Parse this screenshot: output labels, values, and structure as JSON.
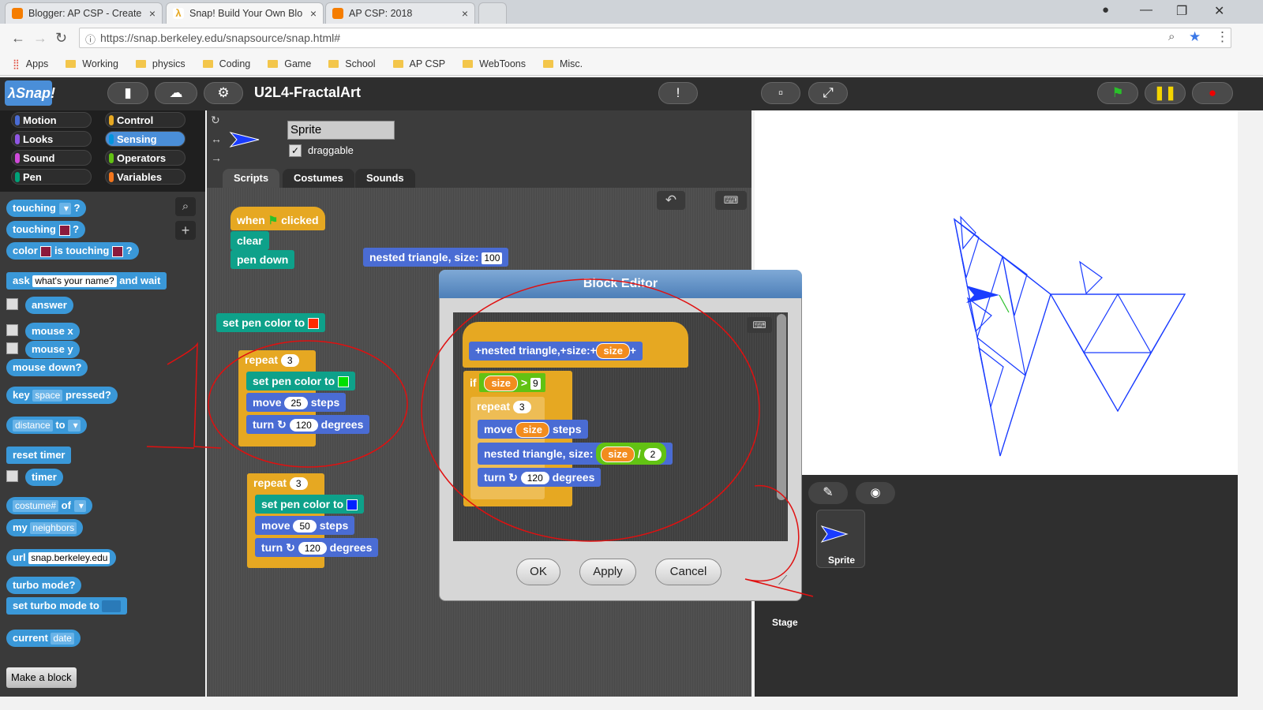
{
  "browser": {
    "tabs": [
      {
        "label": "Blogger: AP CSP - Create",
        "icon": "blogger-icon",
        "color": "#f57d00"
      },
      {
        "label": "Snap! Build Your Own Blo",
        "icon": "snap-lambda-icon",
        "color": "#f3b700"
      },
      {
        "label": "AP CSP: 2018",
        "icon": "blogger-icon",
        "color": "#f57d00"
      }
    ],
    "url": "https://snap.berkeley.edu/snapsource/snap.html#",
    "bookmarks": [
      "Apps",
      "Working",
      "physics",
      "Coding",
      "Game",
      "School",
      "AP CSP",
      "WebToons",
      "Misc."
    ]
  },
  "snap": {
    "project_name": "U2L4-FractalArt",
    "categories": [
      "Motion",
      "Control",
      "Looks",
      "Sensing",
      "Sound",
      "Operators",
      "Pen",
      "Variables"
    ],
    "category_colors": [
      "#4a6cd4",
      "#e6a822",
      "#8f56e3",
      "#0494dc",
      "#cf4ad9",
      "#62c213",
      "#00a178",
      "#f3761d"
    ],
    "selected_category": "Sensing",
    "palette": {
      "touching": "touching",
      "q": "?",
      "color": "color",
      "is_touching": "is touching",
      "ask": "ask",
      "ask_default": "what's your name?",
      "and_wait": "and wait",
      "answer": "answer",
      "mouse_x": "mouse x",
      "mouse_y": "mouse y",
      "mouse_down": "mouse down?",
      "key": "key",
      "key_default": "space",
      "pressed": "pressed?",
      "distance": "distance",
      "to": "to",
      "reset_timer": "reset timer",
      "timer": "timer",
      "costume": "costume#",
      "of": "of",
      "my": "my",
      "neighbors": "neighbors",
      "url": "url",
      "url_default": "snap.berkeley.edu",
      "turbo_mode": "turbo mode?",
      "set_turbo": "set turbo mode to",
      "current": "current",
      "date": "date",
      "make_block": "Make a block"
    },
    "sprite": {
      "name": "Sprite",
      "draggable": "draggable",
      "draggable_checked": true,
      "tabs": [
        "Scripts",
        "Costumes",
        "Sounds"
      ]
    },
    "scripts": {
      "when": "when",
      "clicked": "clicked",
      "clear": "clear",
      "pen_down": "pen down",
      "nested_triangle": "nested triangle, size:",
      "nested_value": "100",
      "set_pen_color": "set pen color to",
      "repeat": "repeat",
      "move": "move",
      "steps": "steps",
      "turn": "turn",
      "degrees": "degrees",
      "repeat1_count": "3",
      "move1": "25",
      "turn1": "120",
      "repeat2_count": "3",
      "move2": "50",
      "turn2": "120",
      "color_red": "#ff2a00",
      "color_green": "#00e000",
      "color_blue": "#0022ff"
    },
    "block_editor": {
      "title": "Block Editor",
      "hat_label": "nested triangle,",
      "size_label": "size:",
      "param": "size",
      "if": "if",
      "gt": ">",
      "threshold": "9",
      "repeat": "repeat",
      "repeat_count": "3",
      "move": "move",
      "steps": "steps",
      "recursive": "nested triangle, size:",
      "divide": "/",
      "divisor": "2",
      "turn": "turn",
      "degrees": "degrees",
      "turn_value": "120",
      "ok": "OK",
      "apply": "Apply",
      "cancel": "Cancel"
    },
    "corral": {
      "sprite_label": "Sprite",
      "stage_label": "Stage"
    },
    "annotation": "1"
  }
}
